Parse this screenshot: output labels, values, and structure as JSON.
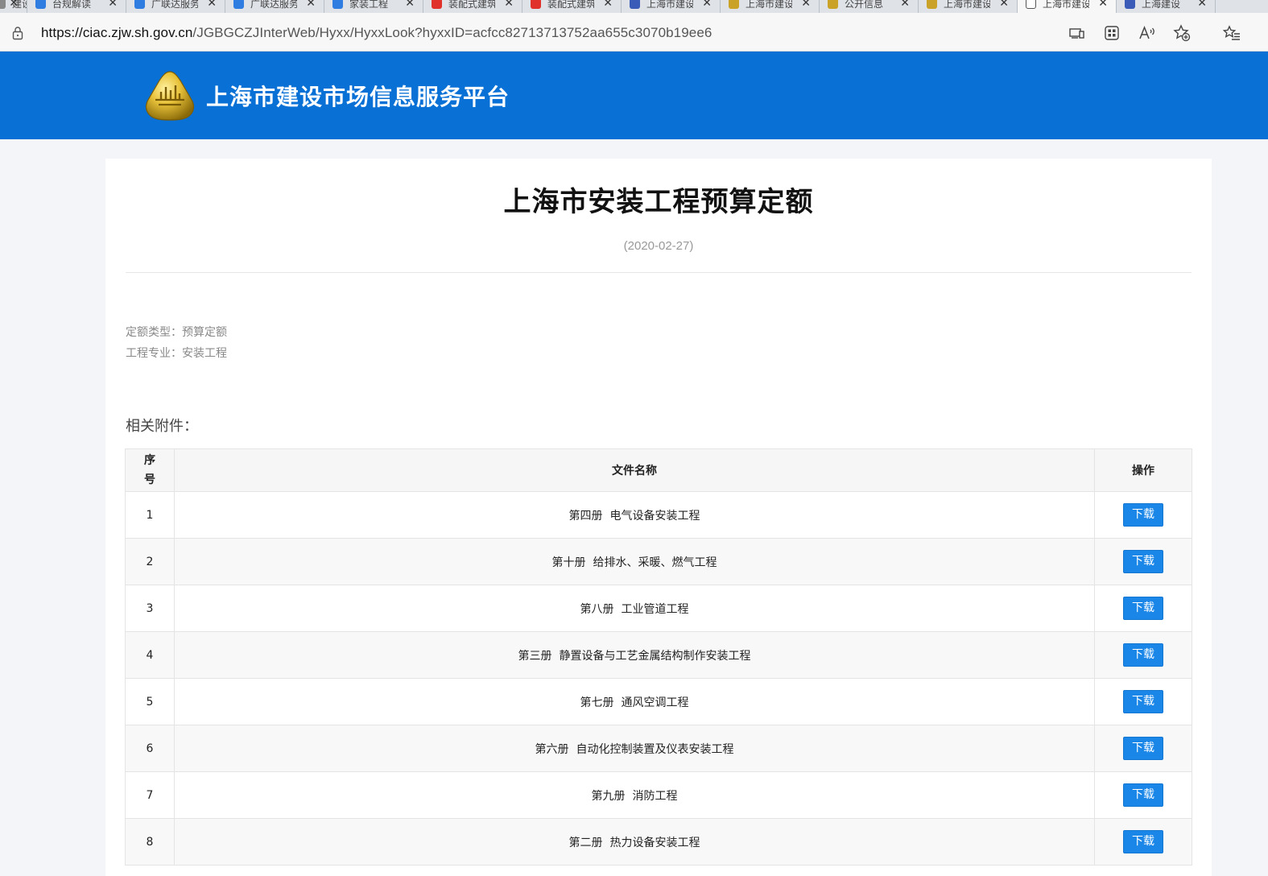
{
  "browser": {
    "tabs": [
      {
        "title": "建设工程",
        "fav": "#888888"
      },
      {
        "title": "台规解读",
        "fav": "#2f7de1"
      },
      {
        "title": "广联达服务",
        "fav": "#2f7de1"
      },
      {
        "title": "广联达服务",
        "fav": "#2f7de1"
      },
      {
        "title": "家装工程",
        "fav": "#2f7de1"
      },
      {
        "title": "装配式建筑",
        "fav": "#e0312b"
      },
      {
        "title": "装配式建筑",
        "fav": "#e0312b"
      },
      {
        "title": "上海市建设",
        "fav": "#3a5bb8"
      },
      {
        "title": "上海市建设",
        "fav": "#c9a227"
      },
      {
        "title": "公开信息",
        "fav": "#c9a227"
      },
      {
        "title": "上海市建设",
        "fav": "#c9a227"
      },
      {
        "title": "上海市建设",
        "fav": "#ffffff"
      },
      {
        "title": "上海建设",
        "fav": "#3a5bb8"
      }
    ],
    "active_tab": 11,
    "url_host": "https://ciac.zjw.sh.gov.cn",
    "url_rest": "/JGBGCZJInterWeb/Hyxx/HyxxLook?hyxxID=acfcc82713713752aa655c3070b19ee6",
    "close_glyph": "✕"
  },
  "site": {
    "title": "上海市建设市场信息服务平台",
    "brand_color": "#0971d6"
  },
  "article": {
    "title": "上海市安装工程预算定额",
    "date": "(2020-02-27)",
    "meta_type": "定额类型：预算定额",
    "meta_discipline": "工程专业：安装工程",
    "attachments_label": "相关附件："
  },
  "table": {
    "headers": {
      "no": "序号",
      "name": "文件名称",
      "op": "操作"
    },
    "download_label": "下载",
    "rows": [
      {
        "no": "1",
        "name": "第四册  电气设备安装工程"
      },
      {
        "no": "2",
        "name": "第十册  给排水、采暖、燃气工程"
      },
      {
        "no": "3",
        "name": "第八册  工业管道工程"
      },
      {
        "no": "4",
        "name": "第三册  静置设备与工艺金属结构制作安装工程"
      },
      {
        "no": "5",
        "name": "第七册  通风空调工程"
      },
      {
        "no": "6",
        "name": "第六册  自动化控制装置及仪表安装工程"
      },
      {
        "no": "7",
        "name": "第九册  消防工程"
      },
      {
        "no": "8",
        "name": "第二册  热力设备安装工程"
      }
    ]
  }
}
